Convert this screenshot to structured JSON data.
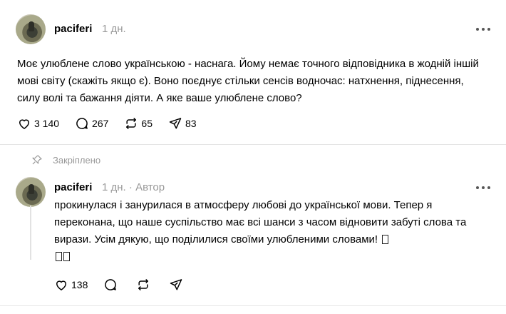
{
  "post": {
    "username": "paciferi",
    "time": "1 дн.",
    "text": "Моє улюблене слово українською - наснага. Йому немає точного відповідника в жодній іншій мові світу (скажіть якщо є). Воно поєднує стільки сенсів водночас: натхнення, піднесення, силу волі та бажання діяти. А яке ваше улюблене слово?",
    "likes": "3 140",
    "comments": "267",
    "reposts": "65",
    "shares": "83"
  },
  "pinned_label": "Закріплено",
  "reply": {
    "username": "paciferi",
    "time": "1 дн.",
    "separator": "·",
    "author_label": "Автор",
    "text": "прокинулася і занурилася в атмосферу любові до української мови. Тепер я переконана, що наше суспільство має всі шанси з часом відновити забуті слова та вирази. Усім дякую, що поділилися своїми улюбленими словами!",
    "likes": "138"
  },
  "icons": {
    "like": "heart-icon",
    "comment": "comment-icon",
    "repost": "repost-icon",
    "share": "send-icon",
    "more": "more-icon",
    "pin": "pin-icon"
  },
  "colors": {
    "text": "#000000",
    "muted": "#999999",
    "divider": "#e5e5e5"
  }
}
